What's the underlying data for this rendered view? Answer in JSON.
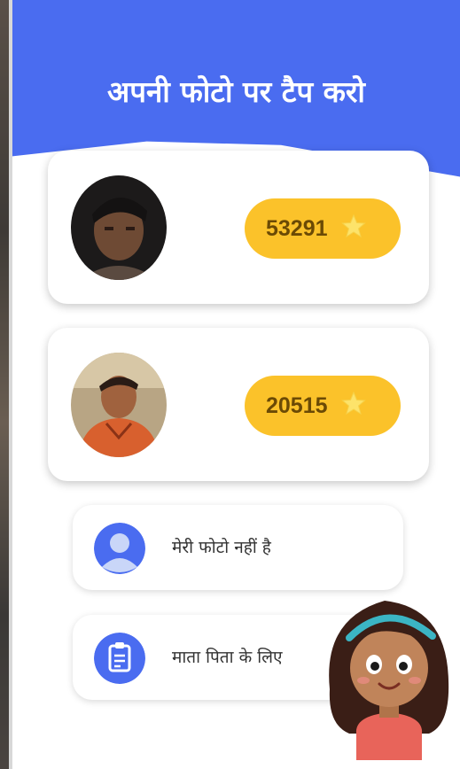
{
  "header": {
    "title": "अपनी फोटो पर टैप करो",
    "background_color": "#4a6cf0"
  },
  "profiles": [
    {
      "points": "53291",
      "icon": "star-icon"
    },
    {
      "points": "20515",
      "icon": "star-icon"
    }
  ],
  "options": [
    {
      "label": "मेरी फोटो नहीं है",
      "icon": "user-icon"
    },
    {
      "label": "माता पिता के लिए",
      "icon": "clipboard-icon"
    }
  ],
  "colors": {
    "accent": "#4a6cf0",
    "points_pill": "#fbc22a",
    "star": "#fde36a"
  }
}
